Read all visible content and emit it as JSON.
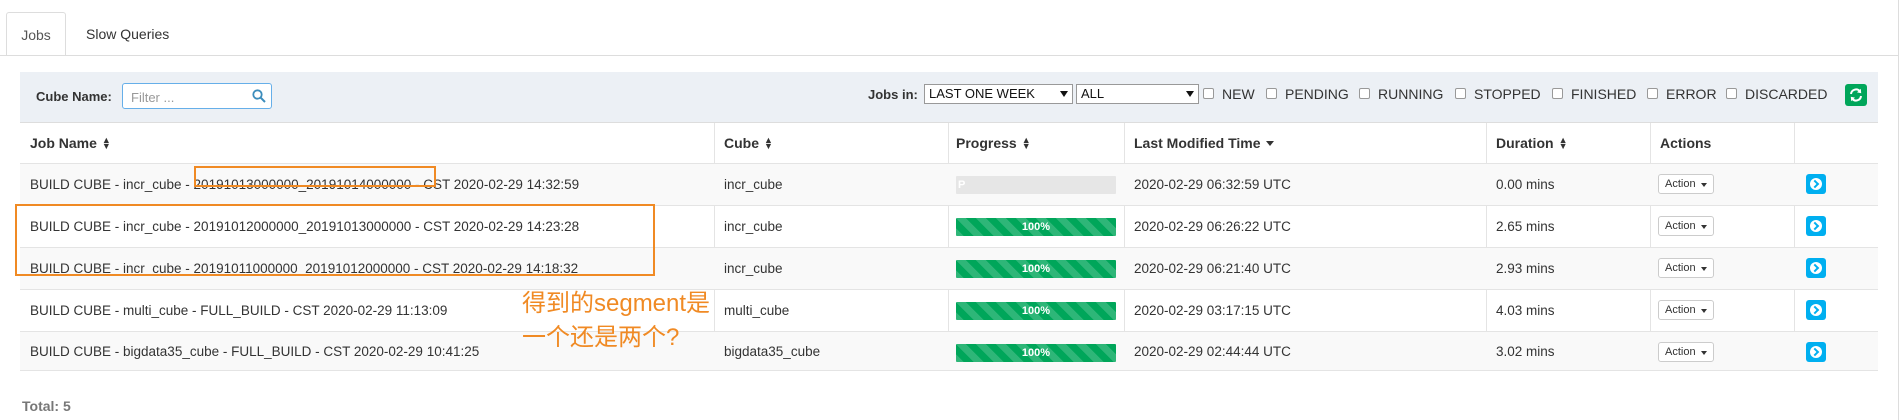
{
  "tabs": [
    {
      "label": "Jobs",
      "active": true
    },
    {
      "label": "Slow Queries",
      "active": false
    }
  ],
  "filters": {
    "cube_name_label": "Cube Name:",
    "search_placeholder": "Filter ...",
    "jobs_in_label": "Jobs in:",
    "time_range": "LAST ONE WEEK",
    "project": "ALL",
    "status_options": [
      "NEW",
      "PENDING",
      "RUNNING",
      "STOPPED",
      "FINISHED",
      "ERROR",
      "DISCARDED"
    ]
  },
  "table": {
    "columns": [
      "Job Name",
      "Cube",
      "Progress",
      "Last Modified Time",
      "Duration",
      "Actions"
    ],
    "action_label": "Action",
    "rows": [
      {
        "job_name": "BUILD CUBE - incr_cube - 20191013000000_20191014000000 - CST 2020-02-29 14:32:59",
        "cube": "incr_cube",
        "progress": 0,
        "progress_label": "P",
        "modified": "2020-02-29 06:32:59 UTC",
        "duration": "0.00 mins"
      },
      {
        "job_name": "BUILD CUBE - incr_cube - 20191012000000_20191013000000 - CST 2020-02-29 14:23:28",
        "cube": "incr_cube",
        "progress": 100,
        "progress_label": "100%",
        "modified": "2020-02-29 06:26:22 UTC",
        "duration": "2.65 mins"
      },
      {
        "job_name": "BUILD CUBE - incr_cube - 20191011000000_20191012000000 - CST 2020-02-29 14:18:32",
        "cube": "incr_cube",
        "progress": 100,
        "progress_label": "100%",
        "modified": "2020-02-29 06:21:40 UTC",
        "duration": "2.93 mins"
      },
      {
        "job_name": "BUILD CUBE - multi_cube - FULL_BUILD - CST 2020-02-29 11:13:09",
        "cube": "multi_cube",
        "progress": 100,
        "progress_label": "100%",
        "modified": "2020-02-29 03:17:15 UTC",
        "duration": "4.03 mins"
      },
      {
        "job_name": "BUILD CUBE - bigdata35_cube - FULL_BUILD - CST 2020-02-29 10:41:25",
        "cube": "bigdata35_cube",
        "progress": 100,
        "progress_label": "100%",
        "modified": "2020-02-29 02:44:44 UTC",
        "duration": "3.02 mins"
      }
    ]
  },
  "total": "Total: 5",
  "annotation": {
    "line1": "得到的segment是",
    "line2": "一个还是两个?"
  },
  "colors": {
    "accent": "#00a65a",
    "info": "#00aff0",
    "annotation": "#f08a24"
  }
}
